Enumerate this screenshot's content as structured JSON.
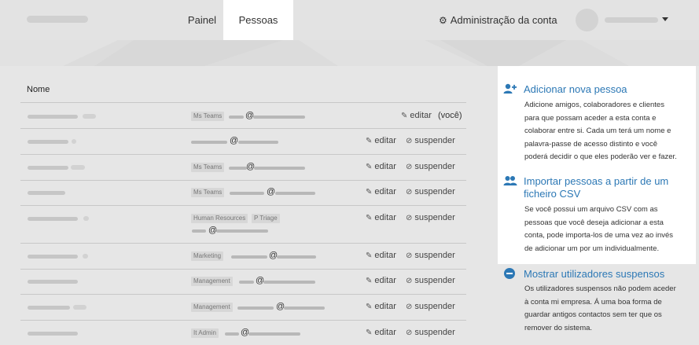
{
  "header": {
    "tabs": [
      {
        "label": "Painel"
      },
      {
        "label": "Pessoas"
      }
    ],
    "admin_label": "Administração da conta",
    "accent": "#2c78b5"
  },
  "table": {
    "column_header": "Nome",
    "edit_label": "editar",
    "suspend_label": "suspender",
    "you_label": "(você)",
    "rows": [
      {
        "tags": [
          "Ms Teams"
        ],
        "is_you": true
      },
      {
        "tags": []
      },
      {
        "tags": [
          "Ms Teams"
        ]
      },
      {
        "tags": [
          "Ms Teams"
        ]
      },
      {
        "tags": [
          "Human Resources",
          "P Triage"
        ]
      },
      {
        "tags": [
          "Marketing"
        ]
      },
      {
        "tags": [
          "Management"
        ]
      },
      {
        "tags": [
          "Management"
        ]
      },
      {
        "tags": [
          "It Admin"
        ]
      }
    ],
    "at_symbol": "@"
  },
  "sidebar": {
    "add": {
      "title": "Adicionar nova pessoa",
      "text_lines": [
        "Adicione amigos, colaboradores e clientes",
        "para que possam aceder a esta conta e",
        "colaborar entre si. Cada um terá um nome e",
        "palavra-passe de acesso distinto e você",
        "poderá decidir o que eles poderão ver e fazer."
      ]
    },
    "import": {
      "title_lines": [
        "Importar pessoas a partir de um",
        "ficheiro CSV"
      ],
      "text_lines": [
        "Se você possui um arquivo CSV com as",
        "pessoas que você deseja adicionar a esta",
        "conta, pode importa-los de uma vez ao invés",
        "de adicionar um por um individualmente."
      ]
    },
    "suspended": {
      "title": "Mostrar utilizadores suspensos",
      "text_lines": [
        "Os utilizadores suspensos não podem aceder",
        "à conta mi empresa. Á uma boa forma de",
        "guardar antigos contactos sem ter que os",
        "remover do sistema."
      ]
    }
  }
}
